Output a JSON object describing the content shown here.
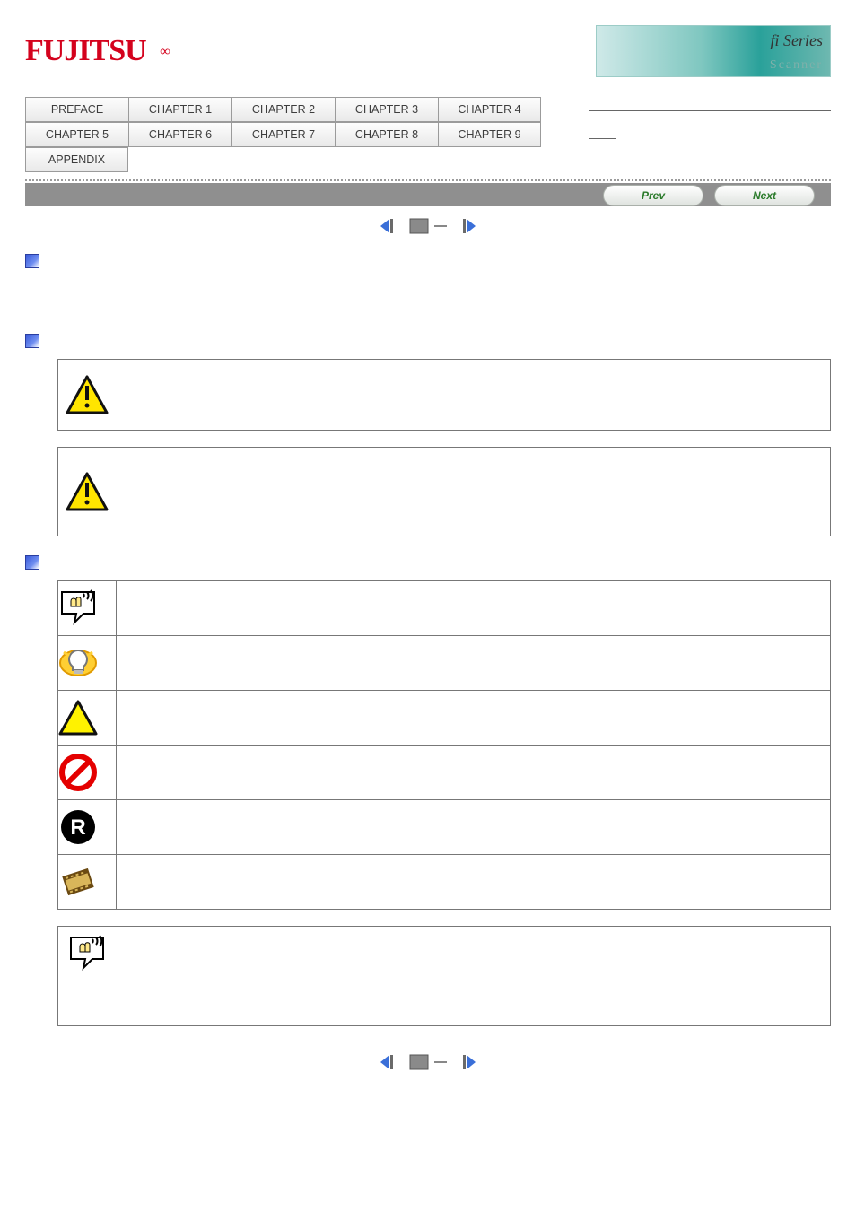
{
  "header": {
    "logo_text": "FUJITSU",
    "banner_main": "fi Series",
    "banner_sub": "Scanner"
  },
  "tabs": [
    "PREFACE",
    "CHAPTER 1",
    "CHAPTER 2",
    "CHAPTER 3",
    "CHAPTER 4",
    "CHAPTER 5",
    "CHAPTER 6",
    "CHAPTER 7",
    "CHAPTER 8",
    "CHAPTER 9",
    "APPENDIX"
  ],
  "nav": {
    "prev": "Prev",
    "next": "Next"
  },
  "sections": {
    "s1": {
      "title": ""
    },
    "s2": {
      "title": "",
      "warn1": "",
      "warn2": ""
    },
    "s3": {
      "title": "",
      "rows": [
        {
          "icon": "attention-hand",
          "text": ""
        },
        {
          "icon": "hint-bulb",
          "text": ""
        },
        {
          "icon": "warning-triangle",
          "text": ""
        },
        {
          "icon": "prohibited",
          "text": ""
        },
        {
          "icon": "recycle",
          "text": ""
        },
        {
          "icon": "movie-clip",
          "text": ""
        }
      ],
      "note": {
        "icon": "attention-hand",
        "text": ""
      }
    }
  }
}
